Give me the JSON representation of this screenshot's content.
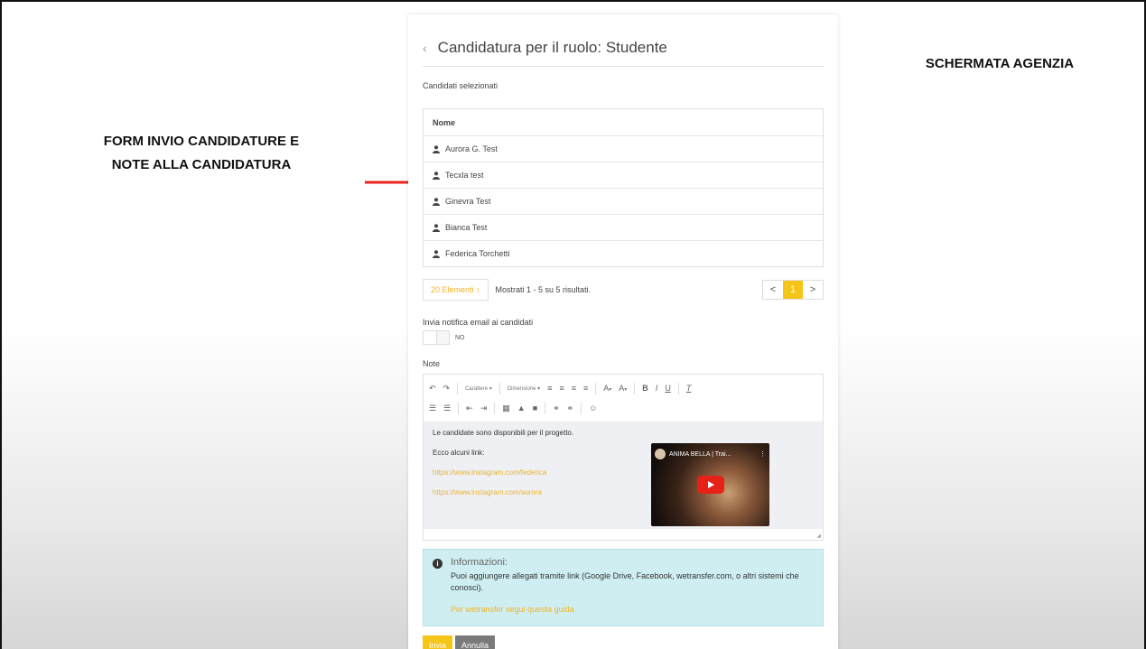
{
  "slide": {
    "left_caption": [
      "FORM INVIO CANDIDATURE E",
      "NOTE ALLA CANDIDATURA"
    ],
    "right_caption": "SCHERMATA AGENZIA",
    "arrow_color": "#e8241c"
  },
  "header": {
    "back_icon": "chevron-left-icon",
    "title": "Candidatura per il ruolo: Studente"
  },
  "selected": {
    "label": "Candidati selezionati",
    "column": "Nome",
    "candidates": [
      "Aurora G. Test",
      "Tecxla test",
      "Ginevra Test",
      "Bianca Test",
      "Federica Torchetti"
    ]
  },
  "pagination": {
    "per_page": "20 Elementi ↕",
    "results": "Mostrati 1 - 5 su 5 risultati.",
    "prev": "<",
    "page": "1",
    "next": ">"
  },
  "notify": {
    "label": "Invia notifica email ai candidati",
    "state": "NO"
  },
  "note": {
    "label": "Note",
    "toolbar": {
      "font": "Carattere",
      "size": "Dimensione",
      "dropdown": "▾"
    },
    "content": {
      "line1": "Le candidate sono disponibili per il progetto.",
      "line2": "Ecco alcuni link:",
      "link1": "https://www.instagram.com/federica",
      "link2": "https://www.instagram.com/aurora"
    },
    "video_title": "ANIMA BELLA | Trai...",
    "video_menu": "⋮"
  },
  "info": {
    "title": "Informazioni:",
    "text": "Puoi aggiungere allegati tramite link (Google Drive, Facebook, wetransfer.com, o altri sistemi che conosci).",
    "link": "Per wetransfer segui questa guida"
  },
  "actions": {
    "submit": "Invia",
    "cancel": "Annulla"
  },
  "colors": {
    "accent": "#f5c518",
    "link": "#f0b429",
    "info_bg": "#cfeef2",
    "cancel": "#7a7a7a"
  }
}
